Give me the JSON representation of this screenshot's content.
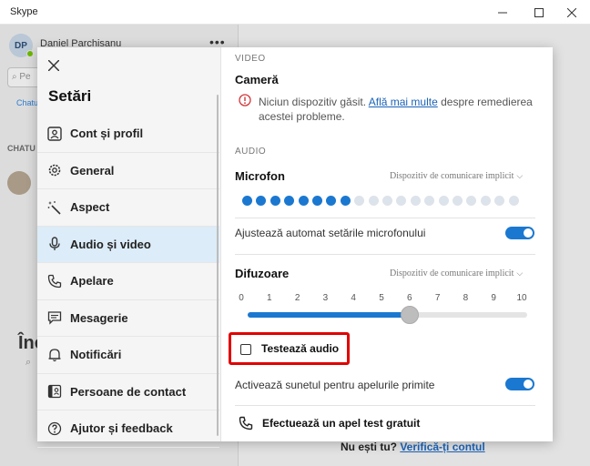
{
  "window": {
    "title": "Skype"
  },
  "background": {
    "profile_initials": "DP",
    "profile_name": "Daniel Parchisanu",
    "search_placeholder": "Pe",
    "chats_tab": "Chatu",
    "chats_label": "CHATU",
    "heading": "Înc",
    "footer_text": "Nu ești tu?",
    "footer_link": "Verifică-ți contul"
  },
  "settings": {
    "title": "Setări",
    "items": [
      {
        "label": "Cont și profil",
        "icon": "account-icon"
      },
      {
        "label": "General",
        "icon": "gear-icon"
      },
      {
        "label": "Aspect",
        "icon": "magic-wand-icon"
      },
      {
        "label": "Audio și video",
        "icon": "microphone-icon",
        "active": true
      },
      {
        "label": "Apelare",
        "icon": "phone-icon"
      },
      {
        "label": "Mesagerie",
        "icon": "chat-icon"
      },
      {
        "label": "Notificări",
        "icon": "bell-icon"
      },
      {
        "label": "Persoane de contact",
        "icon": "contacts-icon"
      },
      {
        "label": "Ajutor și feedback",
        "icon": "help-icon"
      }
    ]
  },
  "video": {
    "section": "VIDEO",
    "camera_label": "Cameră",
    "warning_text_1": "Niciun dispozitiv găsit.",
    "warning_link": "Află mai multe",
    "warning_text_2": "despre remedierea acestei probleme."
  },
  "audio": {
    "section": "AUDIO",
    "mic_label": "Microfon",
    "mic_device": "Dispozitiv de comunicare implicit",
    "mic_level_active_dots": 8,
    "mic_level_total_dots": 20,
    "auto_adjust_label": "Ajustează automat setările microfonului",
    "auto_adjust_on": true,
    "speaker_label": "Difuzoare",
    "speaker_device": "Dispozitiv de comunicare implicit",
    "speaker_ticks": [
      "0",
      "1",
      "2",
      "3",
      "4",
      "5",
      "6",
      "7",
      "8",
      "9",
      "10"
    ],
    "speaker_volume": 5.8,
    "test_audio_label": "Testează audio",
    "incoming_sound_label": "Activează sunetul pentru apelurile primite",
    "incoming_sound_on": true,
    "test_call_label": "Efectuează un apel test gratuit"
  },
  "colors": {
    "accent": "#1b78d0",
    "mic_active": "#1b78d0",
    "mic_inactive": "#dde3ea",
    "highlight": "#e00000"
  }
}
